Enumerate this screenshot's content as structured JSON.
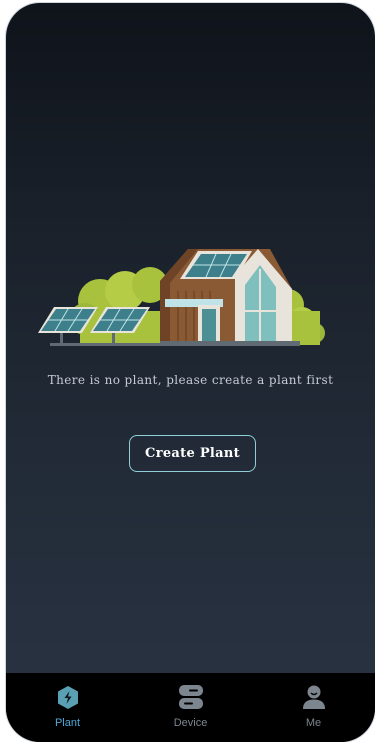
{
  "empty_state": {
    "message": "There is no plant, please create a plant first",
    "create_button": "Create Plant",
    "illustration_icon": "solar-house-illustration"
  },
  "tabbar": {
    "active": "plant",
    "items": [
      {
        "id": "plant",
        "label": "Plant",
        "icon": "plant-icon"
      },
      {
        "id": "device",
        "label": "Device",
        "icon": "device-icon"
      },
      {
        "id": "me",
        "label": "Me",
        "icon": "user-icon"
      }
    ]
  },
  "colors": {
    "accent": "#4fa8d8",
    "button_border": "#8fd0d8",
    "tabbar_bg": "#000000"
  }
}
